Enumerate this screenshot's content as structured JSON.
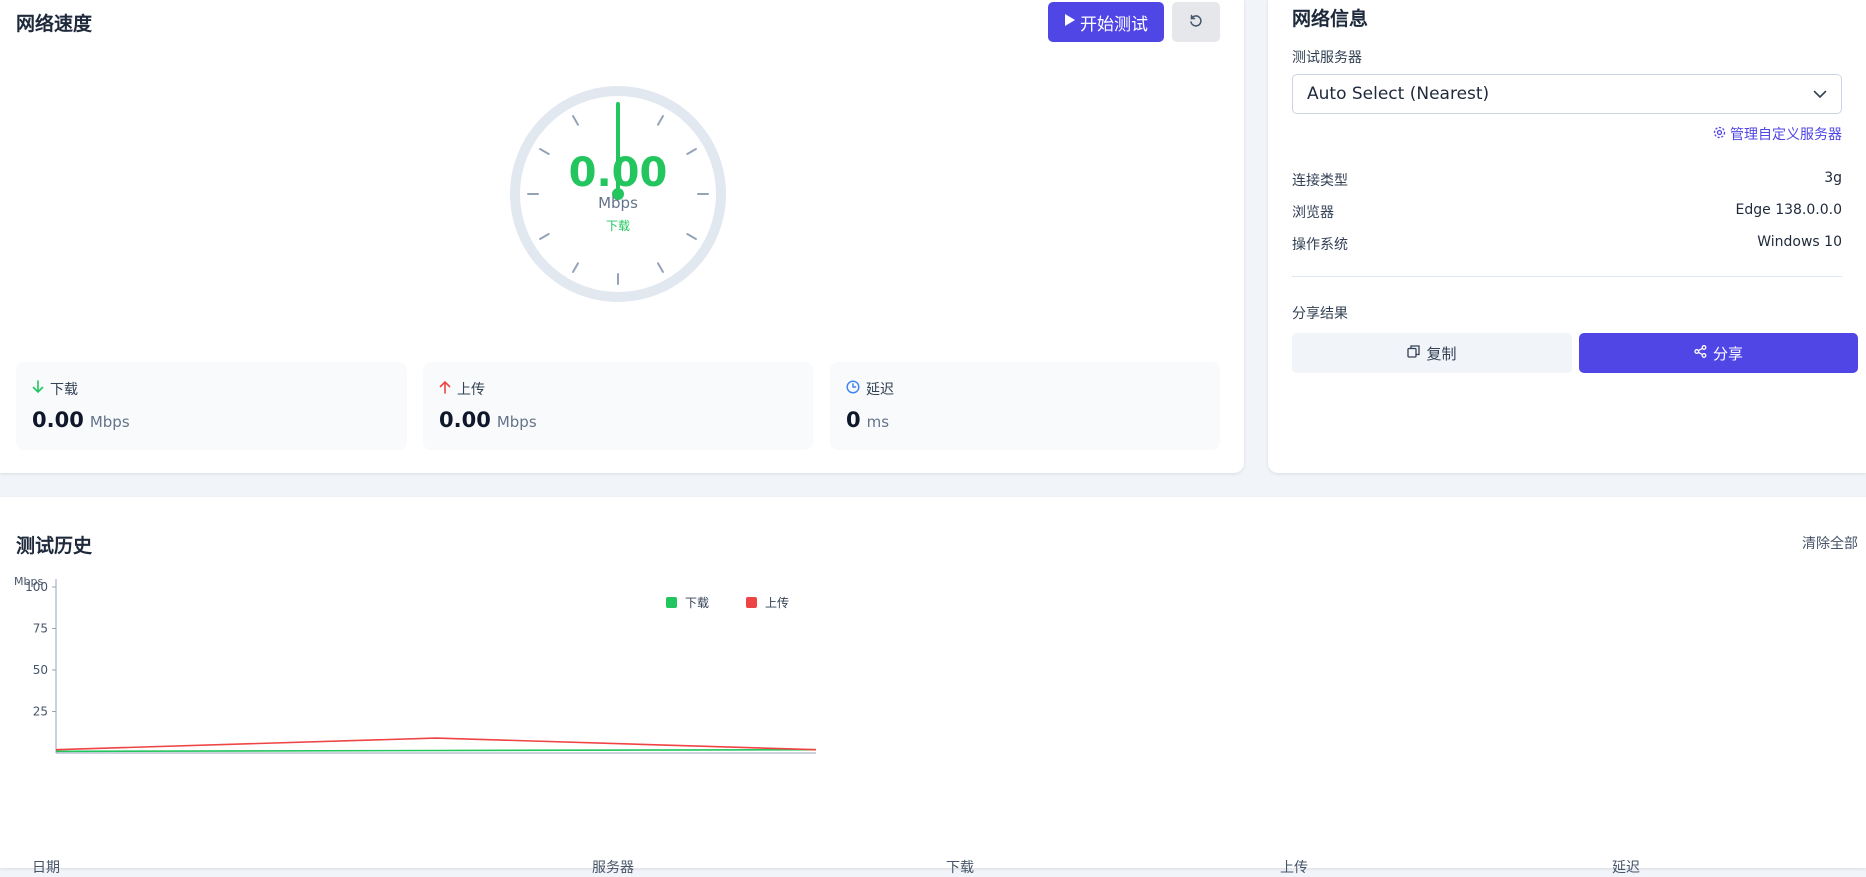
{
  "speed": {
    "title": "网络速度",
    "start_label": "开始测试",
    "gauge": {
      "value": "0.00",
      "unit": "Mbps",
      "mode": "下载"
    },
    "stats": [
      {
        "label": "下载",
        "value": "0.00",
        "unit": "Mbps",
        "icon": "arrow-down-icon",
        "color": "#22c55e"
      },
      {
        "label": "上传",
        "value": "0.00",
        "unit": "Mbps",
        "icon": "arrow-up-icon",
        "color": "#ef4444"
      },
      {
        "label": "延迟",
        "value": "0",
        "unit": "ms",
        "icon": "clock-icon",
        "color": "#3b82f6"
      }
    ]
  },
  "info": {
    "title": "网络信息",
    "server_label": "测试服务器",
    "server_selected": "Auto Select (Nearest)",
    "manage_label": "管理自定义服务器",
    "rows": [
      {
        "label": "连接类型",
        "value": "3g"
      },
      {
        "label": "浏览器",
        "value": "Edge 138.0.0.0"
      },
      {
        "label": "操作系统",
        "value": "Windows 10"
      }
    ],
    "share_title": "分享结果",
    "copy_label": "复制",
    "share_label": "分享"
  },
  "history": {
    "title": "测试历史",
    "clear_label": "清除全部",
    "columns": [
      "日期",
      "服务器",
      "下载",
      "上传",
      "延迟"
    ]
  },
  "chart_data": {
    "type": "line",
    "ylabel": "Mbps",
    "ylim": [
      0,
      100
    ],
    "yticks": [
      25,
      50,
      75,
      100
    ],
    "x": [
      1,
      2,
      3
    ],
    "legend_position": "top",
    "series": [
      {
        "name": "下载",
        "color": "#22c55e",
        "values": [
          1,
          1.5,
          2
        ]
      },
      {
        "name": "上传",
        "color": "#ef4444",
        "values": [
          2,
          9,
          2
        ]
      }
    ]
  }
}
